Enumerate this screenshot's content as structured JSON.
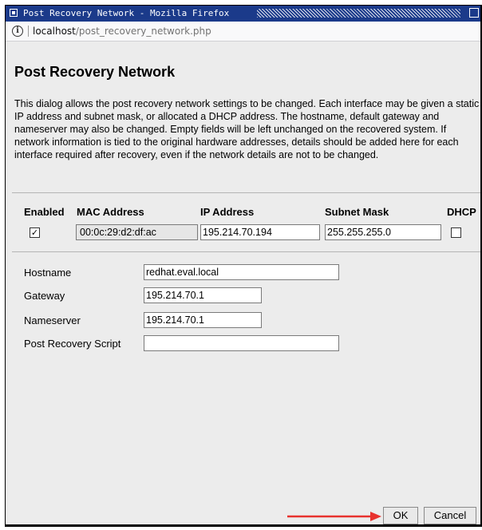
{
  "window": {
    "title": "Post Recovery Network - Mozilla Firefox"
  },
  "browser": {
    "url_host": "localhost",
    "url_path": "/post_recovery_network.php"
  },
  "page": {
    "title": "Post Recovery Network",
    "description": "This dialog allows the post recovery network settings to be changed. Each interface may be given a static IP address and subnet mask, or allocated a DHCP address. The hostname, default gateway and nameserver may also be changed. Empty fields will be left unchanged on the recovered system. If network information is tied to the original hardware addresses, details should be added here for each interface required after recovery, even if the network details are not to be changed."
  },
  "interfaces": {
    "headers": {
      "enabled": "Enabled",
      "mac": "MAC Address",
      "ip": "IP Address",
      "subnet": "Subnet Mask",
      "dhcp": "DHCP"
    },
    "rows": [
      {
        "enabled": true,
        "enabled_mark": "✓",
        "mac": "00:0c:29:d2:df:ac",
        "ip": "195.214.70.194",
        "subnet": "255.255.255.0",
        "dhcp": false
      }
    ]
  },
  "settings": {
    "hostname_label": "Hostname",
    "hostname_value": "redhat.eval.local",
    "gateway_label": "Gateway",
    "gateway_value": "195.214.70.1",
    "nameserver_label": "Nameserver",
    "nameserver_value": "195.214.70.1",
    "script_label": "Post Recovery Script",
    "script_value": ""
  },
  "buttons": {
    "ok": "OK",
    "cancel": "Cancel"
  },
  "colors": {
    "titlebar": "#1b3a8a",
    "content_bg": "#ececec",
    "arrow": "#e8322e"
  }
}
